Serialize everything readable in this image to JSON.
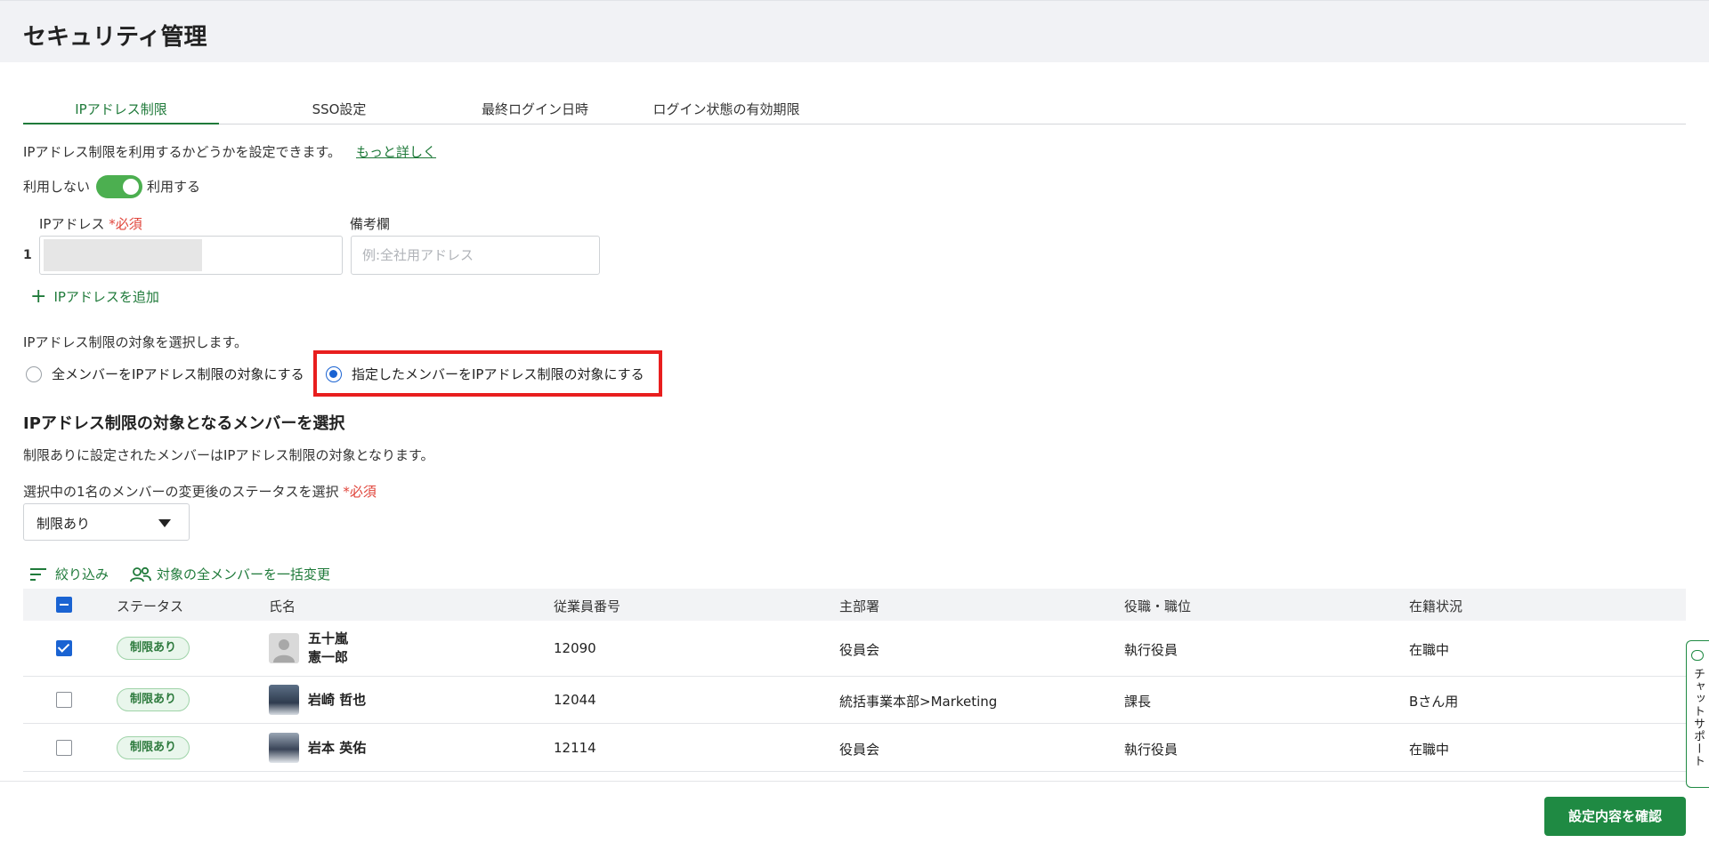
{
  "header": {
    "title": "セキュリティ管理"
  },
  "tabs": [
    {
      "label": "IPアドレス制限",
      "active": true
    },
    {
      "label": "SSO設定",
      "active": false
    },
    {
      "label": "最終ログイン日時",
      "active": false
    },
    {
      "label": "ログイン状態の有効期限",
      "active": false
    }
  ],
  "ip_restriction": {
    "description": "IPアドレス制限を利用するかどうかを設定できます。",
    "more_link": "もっと詳しく",
    "toggle_off_label": "利用しない",
    "toggle_on_label": "利用する",
    "toggle_state": "on",
    "ip_label": "IPアドレス",
    "required_mark": "*必須",
    "memo_label": "備考欄",
    "row_number": "1",
    "memo_placeholder": "例:全社用アドレス",
    "add_ip_label": "IPアドレスを追加"
  },
  "target": {
    "description": "IPアドレス制限の対象を選択します。",
    "option_all": "全メンバーをIPアドレス制限の対象にする",
    "option_selected": "指定したメンバーをIPアドレス制限の対象にする",
    "selected_option": "option_selected"
  },
  "members": {
    "section_title": "IPアドレス制限の対象となるメンバーを選択",
    "section_desc": "制限ありに設定されたメンバーはIPアドレス制限の対象となります。",
    "status_select_label": "選択中の1名のメンバーの変更後のステータスを選択",
    "required_mark": "*必須",
    "status_select_value": "制限あり",
    "filter_label": "絞り込み",
    "bulk_change_label": "対象の全メンバーを一括変更",
    "columns": [
      "ステータス",
      "氏名",
      "従業員番号",
      "主部署",
      "役職・職位",
      "在籍状況"
    ],
    "rows": [
      {
        "checked": true,
        "status": "制限あり",
        "name_line1": "五十嵐",
        "name_line2": "憲一郎",
        "employee_no": "12090",
        "department": "役員会",
        "position": "執行役員",
        "employment": "在職中"
      },
      {
        "checked": false,
        "status": "制限あり",
        "name_line1": "岩崎 哲也",
        "name_line2": "",
        "employee_no": "12044",
        "department": "統括事業本部>Marketing",
        "position": "課長",
        "employment": "Bさん用"
      },
      {
        "checked": false,
        "status": "制限あり",
        "name_line1": "岩本 英佑",
        "name_line2": "",
        "employee_no": "12114",
        "department": "役員会",
        "position": "執行役員",
        "employment": "在職中"
      }
    ]
  },
  "footer": {
    "confirm_label": "設定内容を確認"
  },
  "chat": {
    "label": "チャットサポート"
  },
  "colors": {
    "accent_green": "#1f8a43",
    "toggle_green": "#4caf50",
    "highlight_red": "#e81e1e",
    "checkbox_blue": "#1a63d2",
    "required_red": "#e0443a"
  }
}
